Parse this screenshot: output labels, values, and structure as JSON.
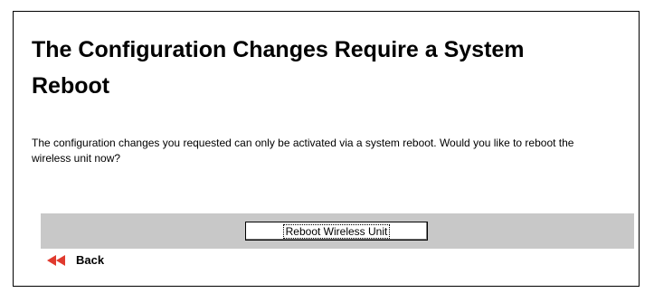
{
  "page": {
    "title": "The Configuration Changes Require a System Reboot",
    "message": "The configuration changes you requested can only be activated via a system reboot. Would you like to reboot the wireless unit now?"
  },
  "actions": {
    "reboot_label": "Reboot Wireless Unit",
    "back_label": "Back",
    "back_icon": "double-left-arrow-icon"
  },
  "colors": {
    "button_bar": "#c8c8c8",
    "back_arrow": "#e03a2e",
    "frame_border": "#000000"
  }
}
